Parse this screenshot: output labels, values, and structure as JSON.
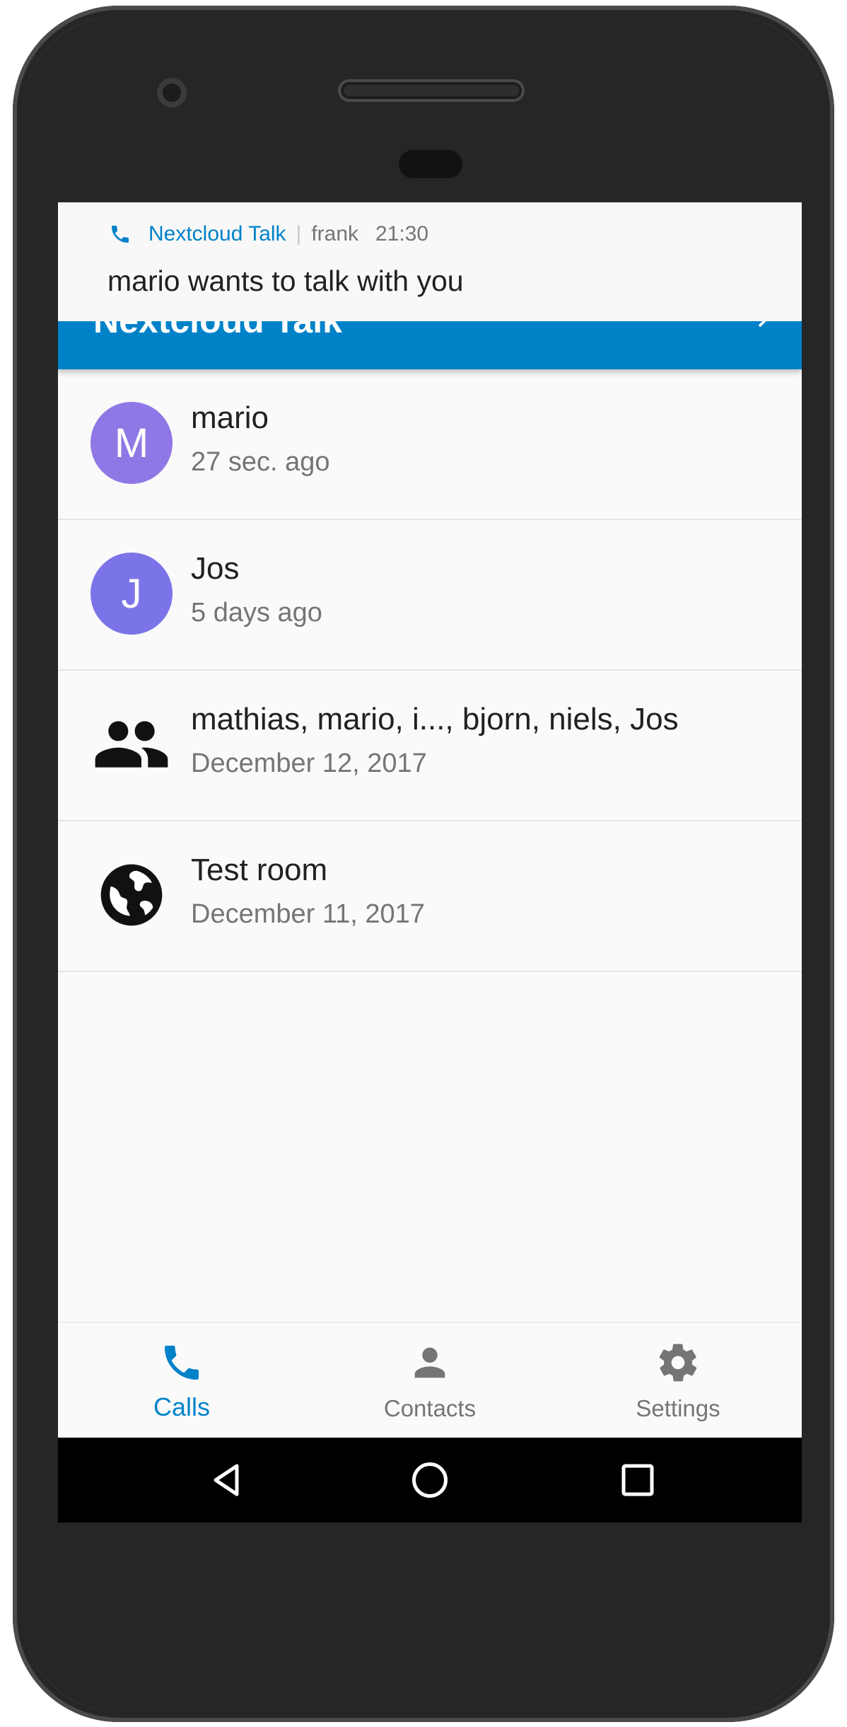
{
  "notification": {
    "app_name": "Nextcloud Talk",
    "separator": "|",
    "user": "frank",
    "time": "21:30",
    "message": "mario wants to talk with you"
  },
  "appbar": {
    "title": "Nextcloud Talk"
  },
  "conversations": [
    {
      "type": "avatar",
      "initial": "M",
      "avatar_color": "#8f78e6",
      "title": "mario",
      "subtitle": "27 sec. ago"
    },
    {
      "type": "avatar",
      "initial": "J",
      "avatar_color": "#7b74e8",
      "title": "Jos",
      "subtitle": "5 days ago"
    },
    {
      "type": "group-icon",
      "title": "mathias, mario, i..., bjorn, niels, Jos",
      "subtitle": "December 12, 2017"
    },
    {
      "type": "globe-icon",
      "title": "Test room",
      "subtitle": "December 11, 2017"
    }
  ],
  "bottom_nav": {
    "items": [
      {
        "label": "Calls",
        "icon": "phone-icon",
        "active": true
      },
      {
        "label": "Contacts",
        "icon": "person-icon",
        "active": false
      },
      {
        "label": "Settings",
        "icon": "gear-icon",
        "active": false
      }
    ]
  },
  "system_nav": {
    "back": "back-icon",
    "home": "home-icon",
    "recents": "recents-icon"
  },
  "colors": {
    "accent": "#0082c9",
    "text_primary": "#212121",
    "text_secondary": "#757575"
  }
}
